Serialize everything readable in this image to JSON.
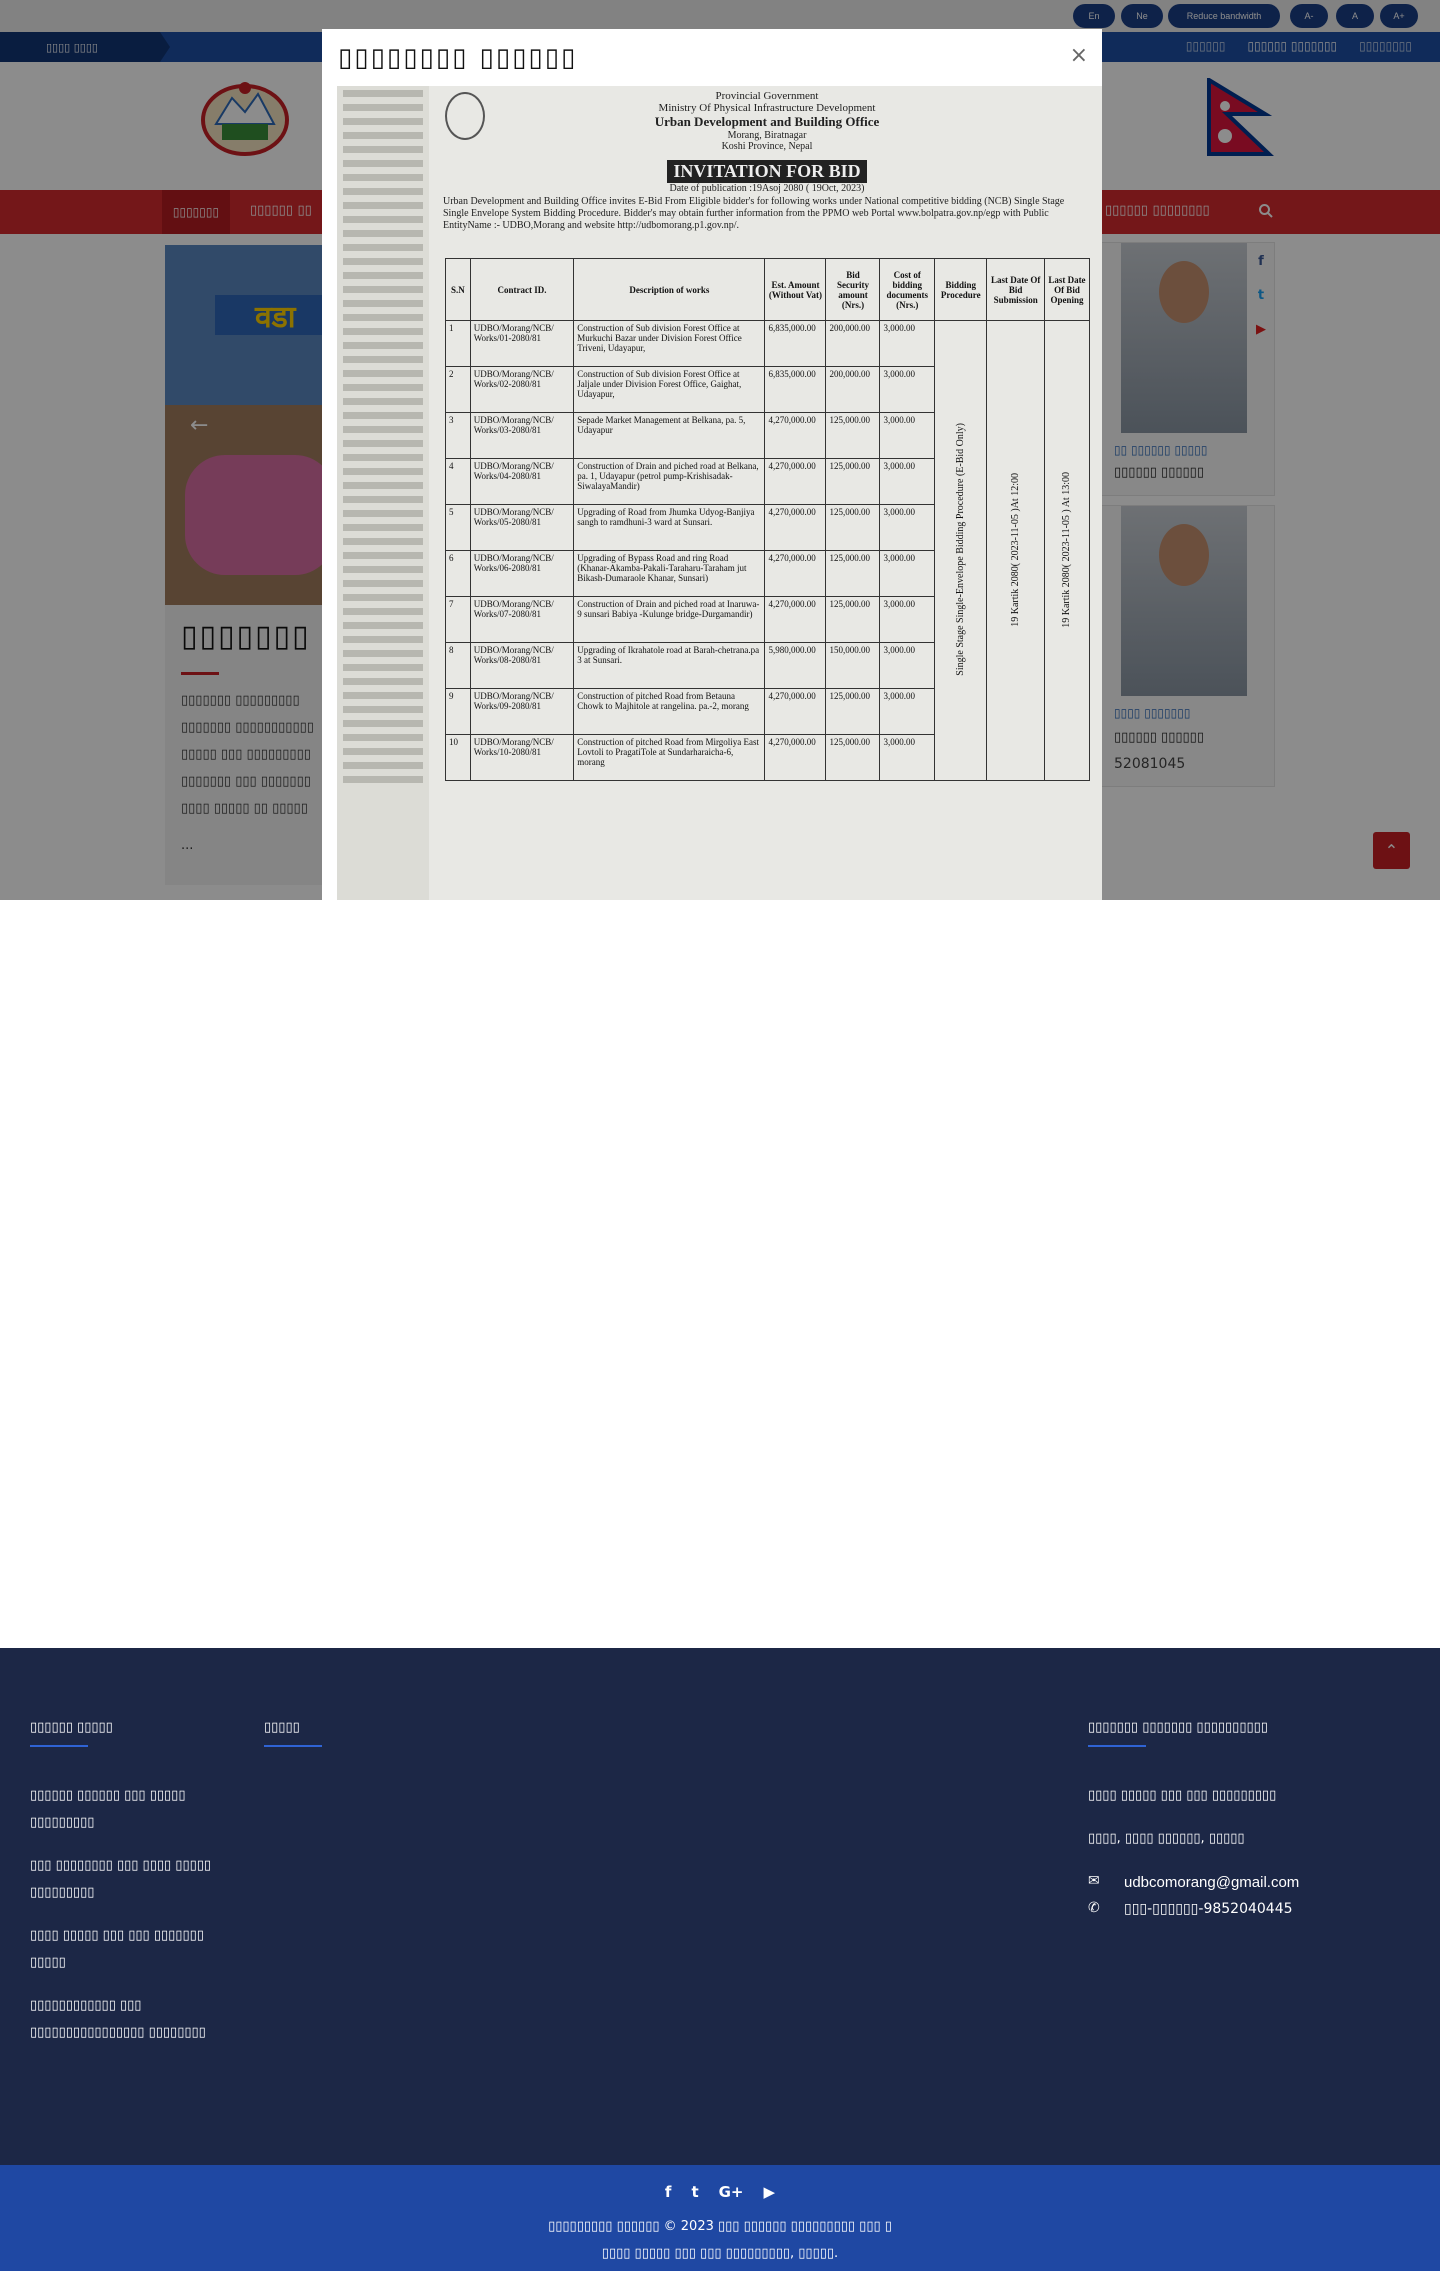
{
  "topbar": {
    "btn_en": "En",
    "btn_ne": "Ne",
    "btn_bandwidth": "Reduce bandwidth",
    "btn_font_minus": "A-",
    "btn_font_normal": "A",
    "btn_font_plus": "A+"
  },
  "datebar": {
    "date": "▯▯▯▯ ▯▯▯▯",
    "links": [
      "▯▯▯▯▯▯",
      "▯▯▯▯▯▯ ▯▯▯▯▯▯▯",
      "▯▯▯▯▯▯▯▯"
    ]
  },
  "nav": {
    "home": "▯▯▯▯▯▯▯",
    "item_about": "▯▯▯▯▯▯ ▯▯",
    "item_right": "▯▯▯▯▯▯ ▯▯▯▯▯▯▯▯",
    "search_icon": "search-icon"
  },
  "intro": {
    "title": "▯▯▯▯▯▯▯ ▯",
    "lines": [
      "▯▯▯▯▯▯▯ ▯▯▯▯▯▯▯▯▯",
      "▯▯▯▯▯▯▯ ▯▯▯▯▯▯▯▯▯▯▯",
      "▯▯▯▯▯  ▯▯▯ ▯▯▯▯▯▯▯▯▯",
      "▯▯▯▯▯▯▯ ▯▯▯ ▯▯▯▯▯▯▯",
      "▯▯▯▯ ▯▯▯▯▯ ▯▯ ▯▯▯▯▯"
    ],
    "more": "..."
  },
  "staff": [
    {
      "title": "▯▯ ▯▯▯▯▯▯ ▯▯▯▯▯",
      "name": "▯▯▯▯▯▯ ▯▯▯▯▯▯"
    },
    {
      "title": "▯▯▯▯ ▯▯▯▯▯▯▯",
      "name": "▯▯▯▯▯▯ ▯▯▯▯▯▯",
      "phone": "52081045"
    }
  ],
  "social_side": [
    "facebook-icon",
    "twitter-icon",
    "youtube-icon"
  ],
  "modal": {
    "title": "▯▯▯▯▯▯▯▯ ▯▯▯▯▯▯",
    "close": "×",
    "notice": {
      "line1": "Provincial Government",
      "line2": "Ministry Of Physical Infrastructure Development",
      "line3": "Urban Development and Building Office",
      "line4": "Morang, Biratnagar",
      "line5": "Koshi Province, Nepal",
      "heading": "INVITATION FOR BID",
      "pubdate": "Date of publication :19Asoj 2080 ( 19Oct, 2023)",
      "para": "Urban Development and Building Office invites E-Bid From Eligible bidder's for following works under National competitive bidding (NCB) Single Stage Single Envelope System Bidding Procedure. Bidder's may obtain further information from the PPMO web Portal www.bolpatra.gov.np/egp with Public EntityName :- UDBO,Morang and website http://udbomorang.p1.gov.np/.",
      "columns": [
        "S.N",
        "Contract ID.",
        "Description of works",
        "Est. Amount (Without Vat)",
        "Bid Security amount (Nrs.)",
        "Cost of bidding documents (Nrs.)",
        "Bidding Procedure",
        "Last Date Of Bid Submission",
        "Last Date Of Bid Opening"
      ],
      "rows": [
        [
          "1",
          "UDBO/Morang/NCB/ Works/01-2080/81",
          "Construction of Sub division Forest Office at Murkuchi Bazar under Division Forest Office Triveni, Udayapur,",
          "6,835,000.00",
          "200,000.00",
          "3,000.00"
        ],
        [
          "2",
          "UDBO/Morang/NCB/ Works/02-2080/81",
          "Construction of Sub division Forest Office at Jaljale under Division Forest Office, Gaighat, Udayapur,",
          "6,835,000.00",
          "200,000.00",
          "3,000.00"
        ],
        [
          "3",
          "UDBO/Morang/NCB/ Works/03-2080/81",
          "Sepade Market Management at Belkana, pa. 5, Udayapur",
          "4,270,000.00",
          "125,000.00",
          "3,000.00"
        ],
        [
          "4",
          "UDBO/Morang/NCB/ Works/04-2080/81",
          "Construction of Drain and piched road at Belkana, pa. 1, Udayapur (petrol pump-Krishisadak-SiwalayaMandir)",
          "4,270,000.00",
          "125,000.00",
          "3,000.00"
        ],
        [
          "5",
          "UDBO/Morang/NCB/ Works/05-2080/81",
          "Upgrading of Road from Jhumka Udyog-Banjiya sangh to ramdhuni-3 ward at Sunsari.",
          "4,270,000.00",
          "125,000.00",
          "3,000.00"
        ],
        [
          "6",
          "UDBO/Morang/NCB/ Works/06-2080/81",
          "Upgrading of Bypass Road and ring Road (Khanar-Akamba-Pakali-Taraharu-Taraham jut Bikash-Dumaraole Khanar, Sunsari)",
          "4,270,000.00",
          "125,000.00",
          "3,000.00"
        ],
        [
          "7",
          "UDBO/Morang/NCB/ Works/07-2080/81",
          "Construction of Drain and piched road at Inaruwa-9 sunsari Babiya -Kulunge bridge-Durgamandir)",
          "4,270,000.00",
          "125,000.00",
          "3,000.00"
        ],
        [
          "8",
          "UDBO/Morang/NCB/ Works/08-2080/81",
          "Upgrading of Ikrahatole road at Barah-chetrana.pa 3 at Sunsari.",
          "5,980,000.00",
          "150,000.00",
          "3,000.00"
        ],
        [
          "9",
          "UDBO/Morang/NCB/ Works/09-2080/81",
          "Construction of pitched Road from Betauna Chowk to Majhitole at rangelina. pa.-2, morang",
          "4,270,000.00",
          "125,000.00",
          "3,000.00"
        ],
        [
          "10",
          "UDBO/Morang/NCB/ Works/10-2080/81",
          "Construction of pitched Road from Mirgoliya East Lovtoli to PragatiTole at Sundarharaicha-6, morang",
          "4,270,000.00",
          "125,000.00",
          "3,000.00"
        ]
      ],
      "procedure": "Single Stage Single-Envelope Bidding Procedure (E-Bid Only)",
      "submission": "19 Kartik 2080( 2023-11-05 )At 12:00",
      "opening": "19 Kartik 2080( 2023-11-05 ) At 13:00"
    }
  },
  "footer": {
    "col1_title": "▯▯▯▯▯▯ ▯▯▯▯▯",
    "col1_links": [
      "▯▯▯▯▯▯ ▯▯▯▯▯▯ ▯▯▯ ▯▯▯▯▯ ▯▯▯▯▯▯▯▯▯",
      "▯▯▯ ▯▯▯▯▯▯▯▯ ▯▯▯ ▯▯▯▯ ▯▯▯▯▯ ▯▯▯▯▯▯▯▯▯",
      "▯▯▯▯ ▯▯▯▯▯ ▯▯▯ ▯▯▯ ▯▯▯▯▯▯▯ ▯▯▯▯▯",
      "▯▯▯▯▯▯▯▯▯▯▯▯ ▯▯▯ ▯▯▯▯▯▯▯▯▯▯▯▯▯▯▯▯ ▯▯▯▯▯▯▯▯"
    ],
    "col2_title": "▯▯▯▯▯",
    "col3_title": "▯▯▯▯▯▯▯ ▯▯▯▯▯▯▯ ▯▯▯▯▯▯▯▯▯▯",
    "office_name": "▯▯▯▯ ▯▯▯▯▯ ▯▯▯ ▯▯▯ ▯▯▯▯▯▯▯▯▯",
    "address": "▯▯▯▯, ▯▯▯▯ ▯▯▯▯▯▯, ▯▯▯▯▯",
    "email": "udbcomorang@gmail.com",
    "phone": "▯▯▯-▯▯▯▯▯▯-9852040445"
  },
  "copyright": {
    "icons": [
      "facebook-icon",
      "twitter-icon",
      "google-plus-icon",
      "youtube-icon"
    ],
    "line1": "▯▯▯▯▯▯▯▯▯ ▯▯▯▯▯▯ © 2023 ▯▯▯ ▯▯▯▯▯▯ ▯▯▯▯▯▯▯▯▯ ▯▯▯ ▯",
    "line2": "▯▯▯▯ ▯▯▯▯▯ ▯▯▯ ▯▯▯ ▯▯▯▯▯▯▯▯▯, ▯▯▯▯▯."
  }
}
